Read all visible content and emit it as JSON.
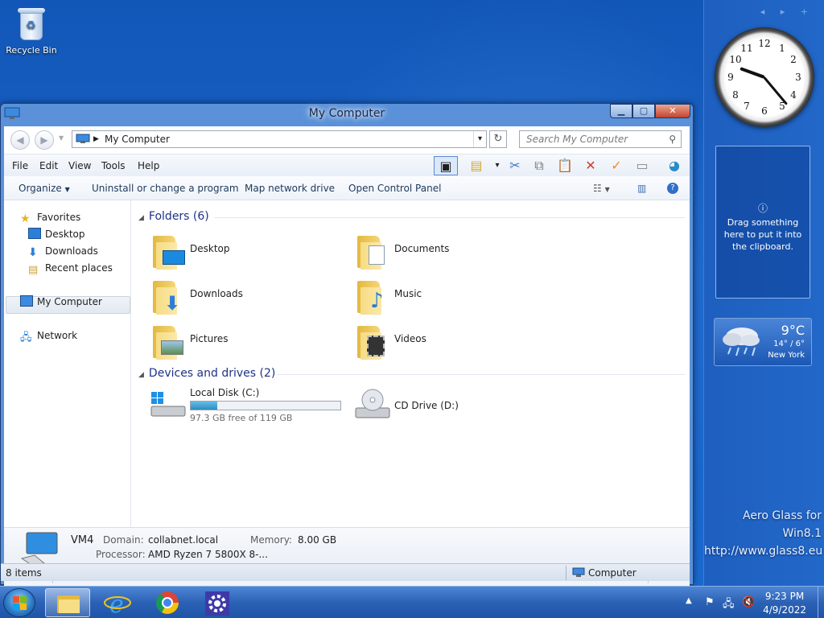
{
  "desktop": {
    "recycle_bin_label": "Recycle Bin",
    "clipboard_gadget_text": "Drag something here to put it into the clipboard.",
    "watermark_line1": "Aero Glass for Win8.1",
    "watermark_line2": "http://www.glass8.eu"
  },
  "clock_gadget": {
    "numbers": [
      "12",
      "1",
      "2",
      "3",
      "4",
      "5",
      "6",
      "7",
      "8",
      "9",
      "10",
      "11"
    ]
  },
  "weather_gadget": {
    "temp": "9°C",
    "range": "14° / 6°",
    "city": "New York"
  },
  "window": {
    "title": "My Computer",
    "address": "My Computer",
    "search_placeholder": "Search My Computer",
    "menu": [
      "File",
      "Edit",
      "View",
      "Tools",
      "Help"
    ],
    "commands": {
      "organize": "Organize",
      "uninstall": "Uninstall or change a program",
      "map_drive": "Map network drive",
      "control_panel": "Open Control Panel"
    },
    "nav": {
      "favorites": "Favorites",
      "desktop": "Desktop",
      "downloads": "Downloads",
      "recent": "Recent places",
      "computer": "My Computer",
      "network": "Network"
    },
    "folders_header": "Folders (6)",
    "folders": [
      "Desktop",
      "Documents",
      "Downloads",
      "Music",
      "Pictures",
      "Videos"
    ],
    "devices_header": "Devices and drives (2)",
    "drives": {
      "c_name": "Local Disk (C:)",
      "c_free": "97.3 GB free of 119 GB",
      "c_used_fraction": 0.18,
      "d_name": "CD Drive (D:)"
    },
    "details": {
      "name": "VM4",
      "domain_label": "Domain:",
      "domain": "collabnet.local",
      "memory_label": "Memory:",
      "memory": "8.00 GB",
      "processor_label": "Processor:",
      "processor": "AMD Ryzen 7 5800X 8-..."
    },
    "status_items": "8 items",
    "status2_items": "8 items",
    "status2_location": "Computer"
  },
  "taskbar": {
    "time": "9:23 PM",
    "date": "4/9/2022"
  }
}
